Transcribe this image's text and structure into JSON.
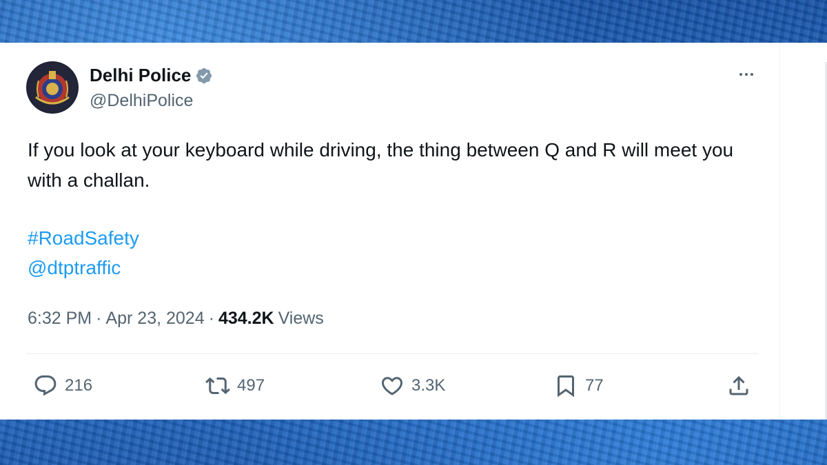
{
  "tweet": {
    "author": {
      "name": "Delhi Police",
      "handle": "@DelhiPolice",
      "verified": true,
      "avatar_icon": "delhi-police-emblem"
    },
    "text": "If you look at your keyboard while driving, the thing between Q and R will meet you with a challan.",
    "hashtag": "#RoadSafety",
    "mention": "@dtptraffic",
    "time": "6:32 PM",
    "separator": "·",
    "date": "Apr 23, 2024",
    "views_count": "434.2K",
    "views_label": "Views",
    "stats": {
      "replies": "216",
      "reposts": "497",
      "likes": "3.3K",
      "bookmarks": "77"
    }
  },
  "colors": {
    "link": "#1d9bf0",
    "secondary_text": "#536471",
    "primary_text": "#0f1419",
    "verified_badge": "#829aab"
  }
}
